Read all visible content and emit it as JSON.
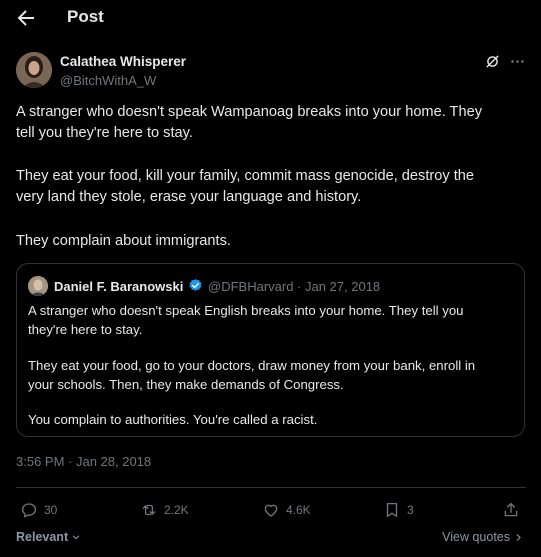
{
  "header": {
    "title": "Post"
  },
  "author": {
    "name": "Calathea Whisperer",
    "handle": "@BitchWithA_W"
  },
  "tweet": {
    "lines": [
      "A stranger who doesn't speak Wampanoag breaks into your home. They",
      "tell you they're here to stay.",
      "They eat your food, kill your family, commit mass genocide, destroy the",
      "very land they stole, erase your language and history.",
      "They complain about immigrants."
    ]
  },
  "quote": {
    "name": "Daniel F. Baranowski",
    "handle_date": "@DFBHarvard · Jan 27, 2018",
    "lines": [
      "A stranger who doesn't speak English breaks into your home. They tell you",
      "they're here to stay.",
      "They eat your food, go to your doctors, draw money from your bank, enroll in",
      "your schools. Then, they make demands of Congress.",
      "You complain to authorities. You're called a racist."
    ]
  },
  "timestamp": "3:56 PM · Jan 28, 2018",
  "actions": {
    "replies": "30",
    "reposts": "2.2K",
    "likes": "4.6K",
    "bookmarks": "3"
  },
  "footer": {
    "relevant": "Relevant",
    "view_quotes": "View quotes"
  },
  "colors": {
    "background": "#000000",
    "text": "#e7e9ea",
    "muted": "#71767b",
    "verified": "#1d9bf0",
    "border": "#2f3336"
  }
}
